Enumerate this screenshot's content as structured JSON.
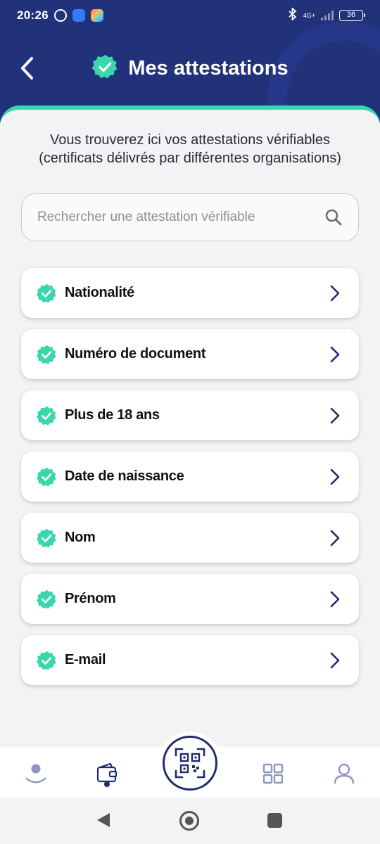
{
  "status_bar": {
    "time": "20:26",
    "network": "4G+",
    "battery": "36"
  },
  "header": {
    "title": "Mes attestations"
  },
  "intro": {
    "line1": "Vous trouverez ici vos attestations vérifiables",
    "line2": "(certificats délivrés par différentes organisations)"
  },
  "search": {
    "placeholder": "Rechercher une attestation vérifiable"
  },
  "attestations": [
    {
      "label": "Nationalité"
    },
    {
      "label": "Numéro de document"
    },
    {
      "label": "Plus de 18 ans"
    },
    {
      "label": "Date de naissance"
    },
    {
      "label": "Nom"
    },
    {
      "label": "Prénom"
    },
    {
      "label": "E-mail"
    }
  ],
  "colors": {
    "header_bg": "#21317a",
    "accent": "#3cd6ad",
    "nav_active": "#1f2b6b"
  },
  "icons": {
    "back": "chevron-left-icon",
    "title": "verified-badge-icon",
    "search": "search-icon",
    "item_check": "verified-badge-icon",
    "item_chevron": "chevron-right-icon",
    "nav": [
      "home-person-icon",
      "wallet-icon",
      "qr-scan-icon",
      "grid-icon",
      "profile-icon"
    ]
  }
}
